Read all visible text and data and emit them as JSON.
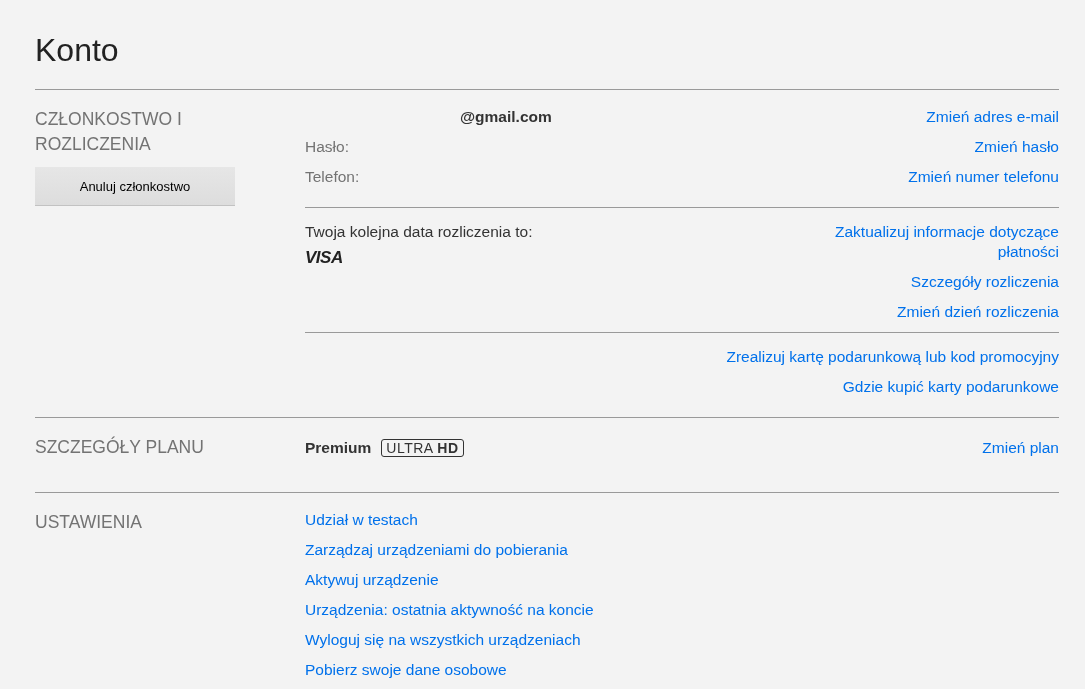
{
  "title": "Konto",
  "membership": {
    "heading": "CZŁONKOSTWO I ROZLICZENIA",
    "cancel_button": "Anuluj członkostwo",
    "account_rows": [
      {
        "label": "",
        "value": "@gmail.com",
        "link": "Zmień adres e-mail"
      },
      {
        "label": "Hasło:",
        "value": "",
        "link": "Zmień hasło"
      },
      {
        "label": "Telefon:",
        "value": "",
        "link": "Zmień numer telefonu"
      }
    ],
    "billing": {
      "text": "Twoja kolejna data rozliczenia to:",
      "card": "VISA",
      "links": [
        "Zaktualizuj informacje dotyczące płatności",
        "Szczegóły rozliczenia",
        "Zmień dzień rozliczenia"
      ]
    },
    "gift_links": [
      "Zrealizuj kartę podarunkową lub kod promocyjny",
      "Gdzie kupić karty podarunkowe"
    ]
  },
  "plan": {
    "heading": "SZCZEGÓŁY PLANU",
    "name": "Premium",
    "badge": "ULTRA **HD**",
    "link": "Zmień plan"
  },
  "settings": {
    "heading": "USTAWIENIA",
    "links": [
      "Udział w testach",
      "Zarządzaj urządzeniami do pobierania",
      "Aktywuj urządzenie",
      "Urządzenia: ostatnia aktywność na koncie",
      "Wyloguj się na wszystkich urządzeniach",
      "Pobierz swoje dane osobowe"
    ]
  }
}
